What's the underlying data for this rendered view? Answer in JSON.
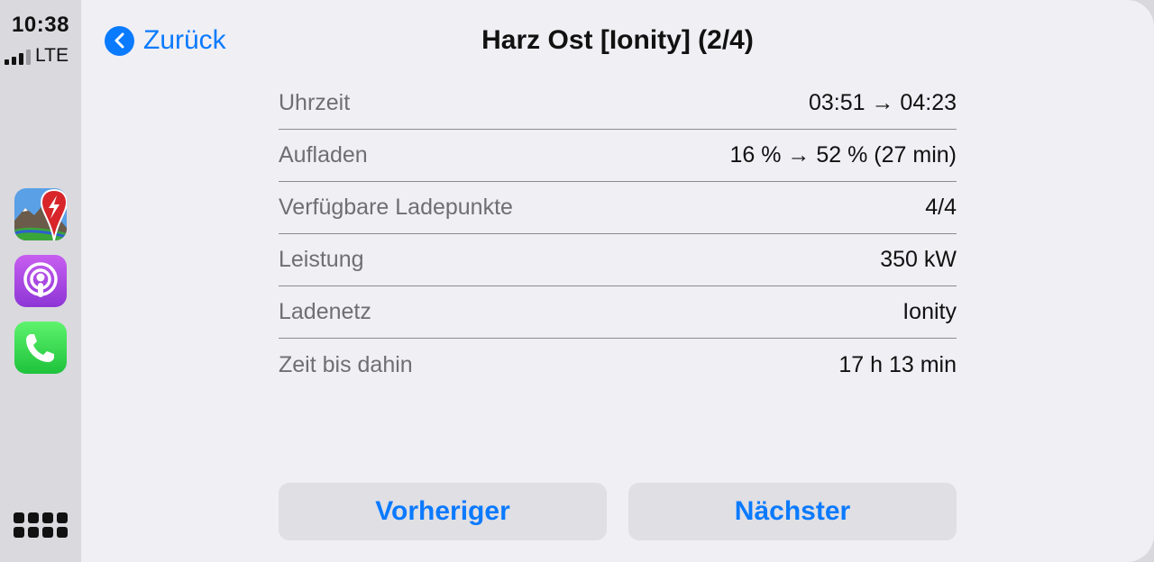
{
  "status": {
    "time": "10:38",
    "network": "LTE"
  },
  "dock": {
    "apps": [
      {
        "name": "ev-charging-app-icon"
      },
      {
        "name": "podcasts-app-icon"
      },
      {
        "name": "phone-app-icon"
      }
    ]
  },
  "nav": {
    "back_label": "Zurück",
    "title": "Harz Ost [Ionity]  (2/4)"
  },
  "details": [
    {
      "key": "Uhrzeit",
      "value": "03:51 → 04:23"
    },
    {
      "key": "Aufladen",
      "value": "16 % → 52 % (27 min)"
    },
    {
      "key": "Verfügbare Ladepunkte",
      "value": "4/4"
    },
    {
      "key": "Leistung",
      "value": "350 kW"
    },
    {
      "key": "Ladenetz",
      "value": "Ionity"
    },
    {
      "key": "Zeit bis dahin",
      "value": "17 h 13 min"
    }
  ],
  "buttons": {
    "previous": "Vorheriger",
    "next": "Nächster"
  },
  "colors": {
    "accent": "#0a7aff",
    "background": "#efeff4",
    "dock": "#d9d9de"
  }
}
